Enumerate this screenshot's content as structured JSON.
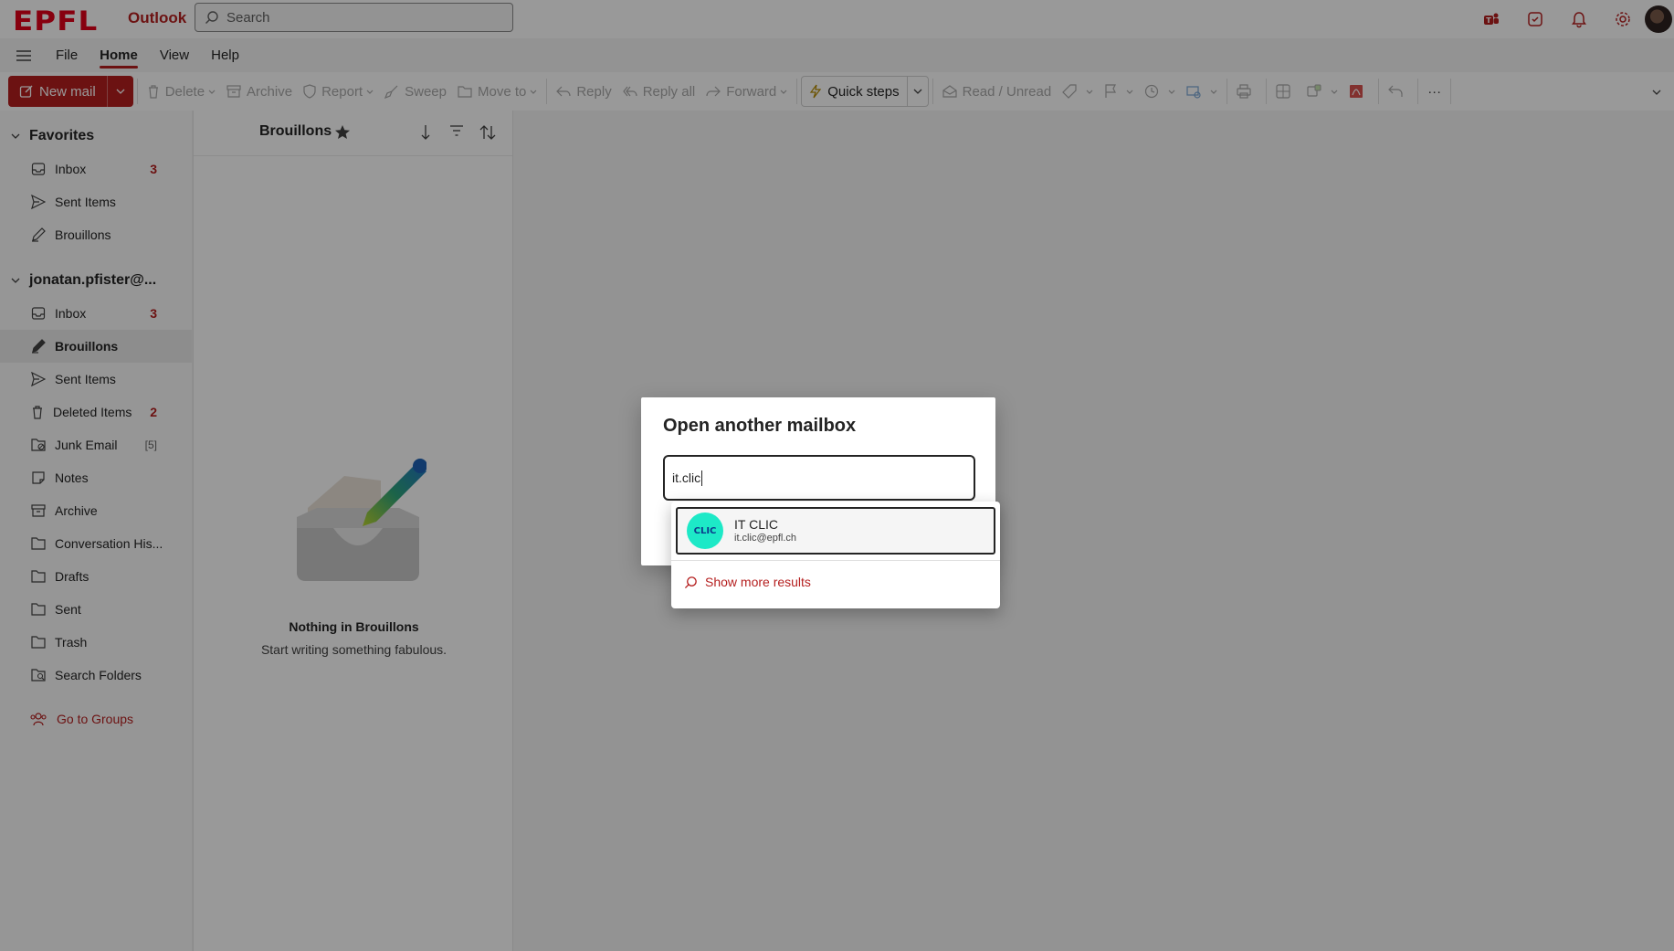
{
  "topbar": {
    "logo": "EPFL",
    "app_name": "Outlook",
    "search_placeholder": "Search"
  },
  "menu": {
    "tabs": [
      "File",
      "Home",
      "View",
      "Help"
    ],
    "active": "Home"
  },
  "ribbon": {
    "new_mail": "New mail",
    "delete": "Delete",
    "archive": "Archive",
    "report": "Report",
    "sweep": "Sweep",
    "move_to": "Move to",
    "reply": "Reply",
    "reply_all": "Reply all",
    "forward": "Forward",
    "quick_steps": "Quick steps",
    "read_unread": "Read / Unread",
    "more": "···"
  },
  "sidebar": {
    "favorites": {
      "title": "Favorites",
      "items": [
        {
          "label": "Inbox",
          "count": "3"
        },
        {
          "label": "Sent Items",
          "count": ""
        },
        {
          "label": "Brouillons",
          "count": ""
        }
      ]
    },
    "account": {
      "title": "jonatan.pfister@...",
      "items": [
        {
          "label": "Inbox",
          "count": "3"
        },
        {
          "label": "Brouillons",
          "count": ""
        },
        {
          "label": "Sent Items",
          "count": ""
        },
        {
          "label": "Deleted Items",
          "count": "2"
        },
        {
          "label": "Junk Email",
          "count": "[5]"
        },
        {
          "label": "Notes",
          "count": ""
        },
        {
          "label": "Archive",
          "count": ""
        },
        {
          "label": "Conversation His...",
          "count": ""
        },
        {
          "label": "Drafts",
          "count": ""
        },
        {
          "label": "Sent",
          "count": ""
        },
        {
          "label": "Trash",
          "count": ""
        },
        {
          "label": "Search Folders",
          "count": ""
        }
      ]
    },
    "go_to_groups": "Go to Groups"
  },
  "message_list": {
    "folder_title": "Brouillons",
    "empty_title": "Nothing in Brouillons",
    "empty_subtitle": "Start writing something fabulous."
  },
  "dialog": {
    "title": "Open another mailbox",
    "input_value": "it.clic",
    "suggestion": {
      "avatar_text": "CLIC",
      "name": "IT CLIC",
      "email": "it.clic@epfl.ch"
    },
    "show_more": "Show more results"
  },
  "colors": {
    "accent": "#b51f1f",
    "logo_red": "#e2001a",
    "avatar_teal": "#1de9c7"
  }
}
